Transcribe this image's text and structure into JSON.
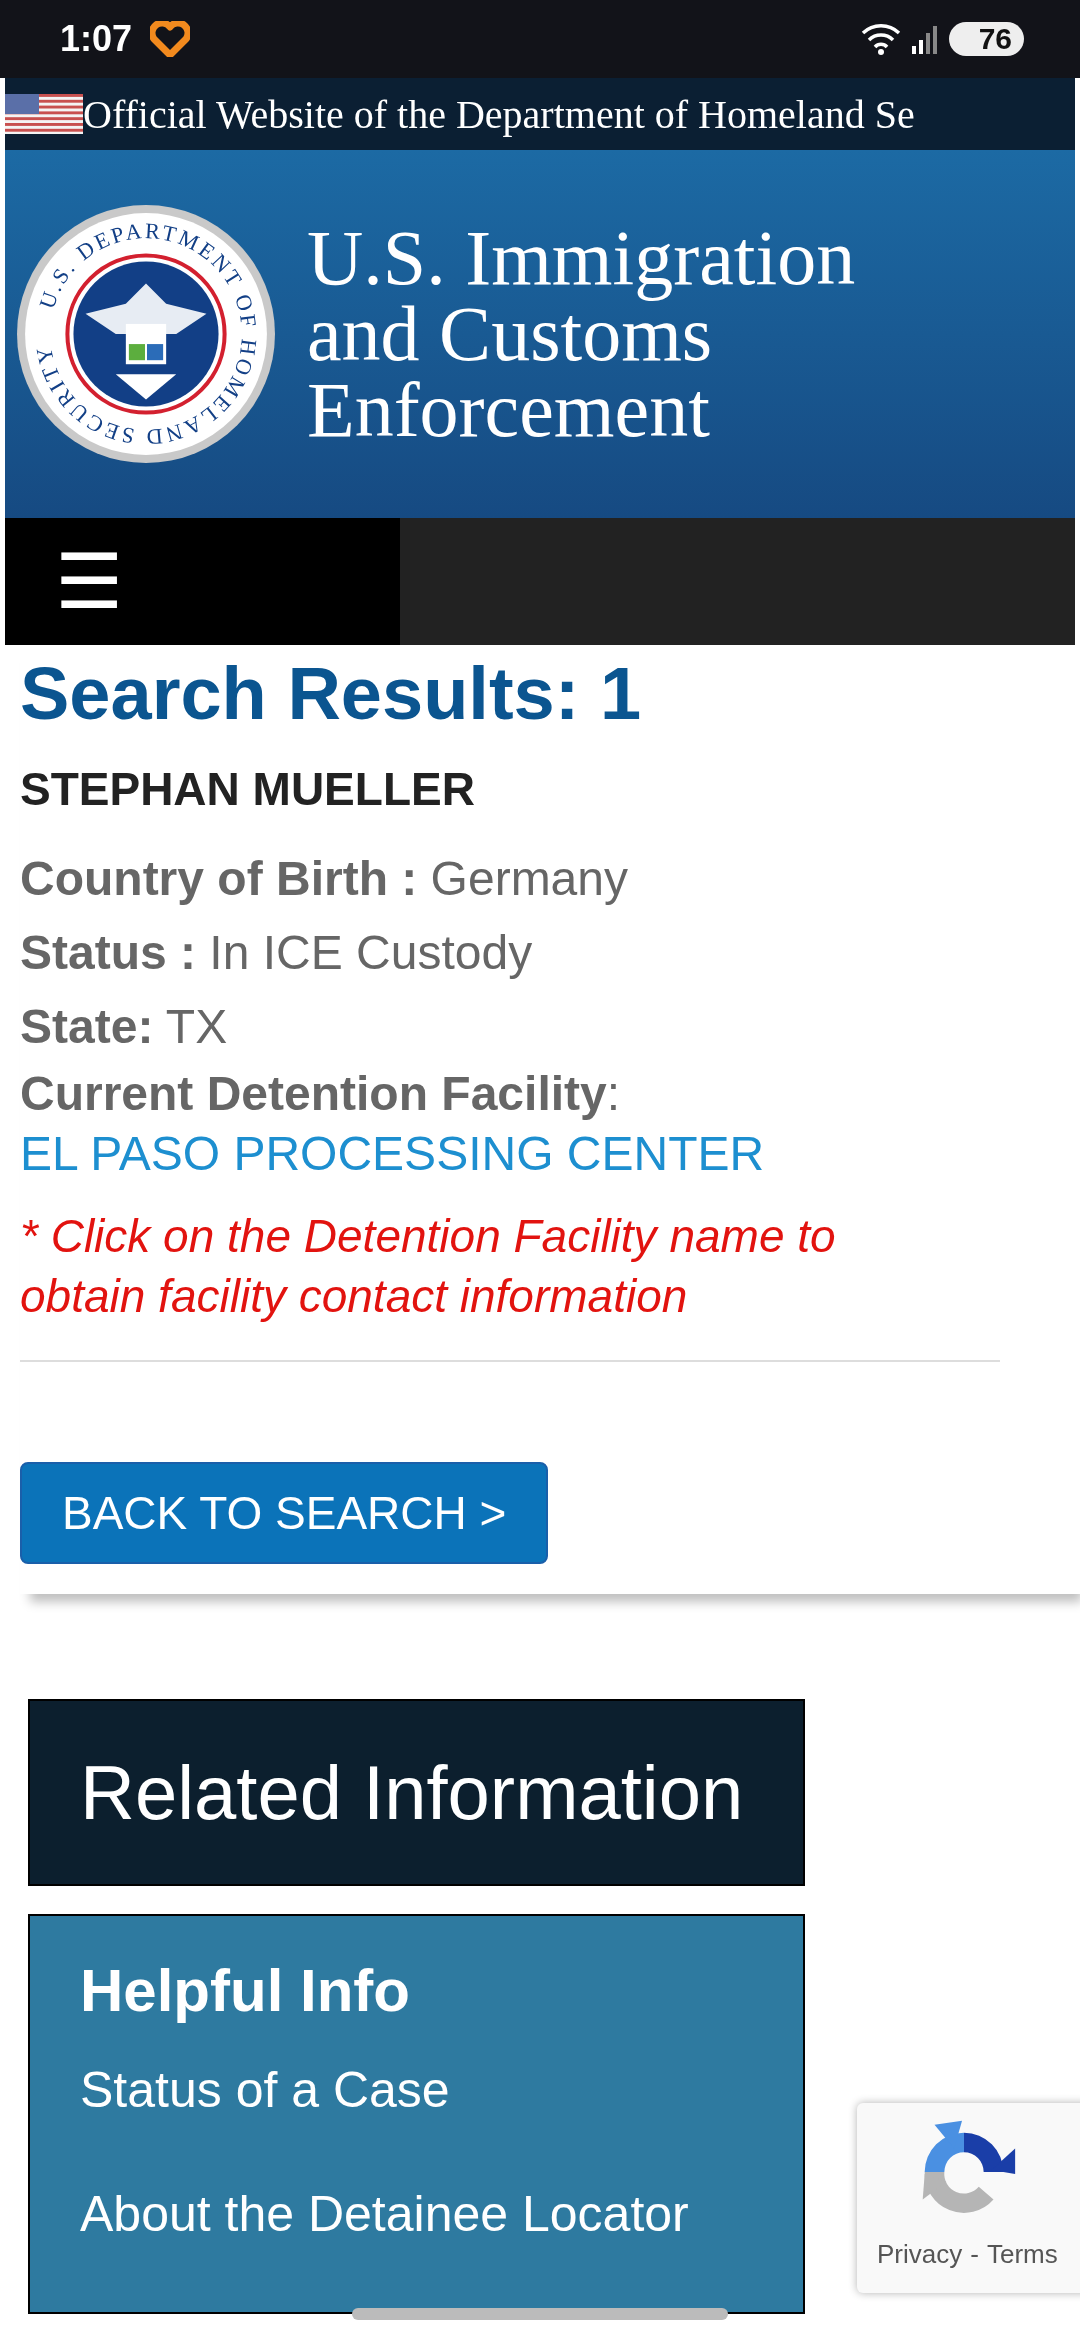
{
  "status_bar": {
    "time": "1:07",
    "battery": "76"
  },
  "gov_banner": {
    "text": "Official Website of the Department of Homeland Se"
  },
  "header": {
    "seal_text": "U.S. DEPARTMENT OF HOMELAND SECURITY",
    "agency_lines": [
      "U.S. Immigration",
      "and Customs",
      "Enforcement"
    ]
  },
  "nav": {
    "menu_glyph": "☰"
  },
  "results": {
    "heading": "Search Results: 1",
    "name": "STEPHAN MUELLER",
    "fields": [
      {
        "label": "Country of Birth :",
        "value": "Germany",
        "kind": "text"
      },
      {
        "label": "Status :",
        "value": "In ICE Custody",
        "kind": "text"
      },
      {
        "label": "State:",
        "value": "TX",
        "kind": "text"
      },
      {
        "label": "Current Detention Facility",
        "separator": ":",
        "value": "EL PASO PROCESSING CENTER",
        "kind": "link"
      }
    ],
    "note": "* Click on the Detention Facility name to obtain facility contact information",
    "back_button": "BACK TO SEARCH >"
  },
  "related": {
    "title": "Related Information"
  },
  "helpful": {
    "title": "Helpful Info",
    "links": [
      "Status of a Case",
      "About the Detainee Locator"
    ]
  },
  "recaptcha": {
    "privacy": "Privacy",
    "separator": "-",
    "terms": "Terms"
  }
}
